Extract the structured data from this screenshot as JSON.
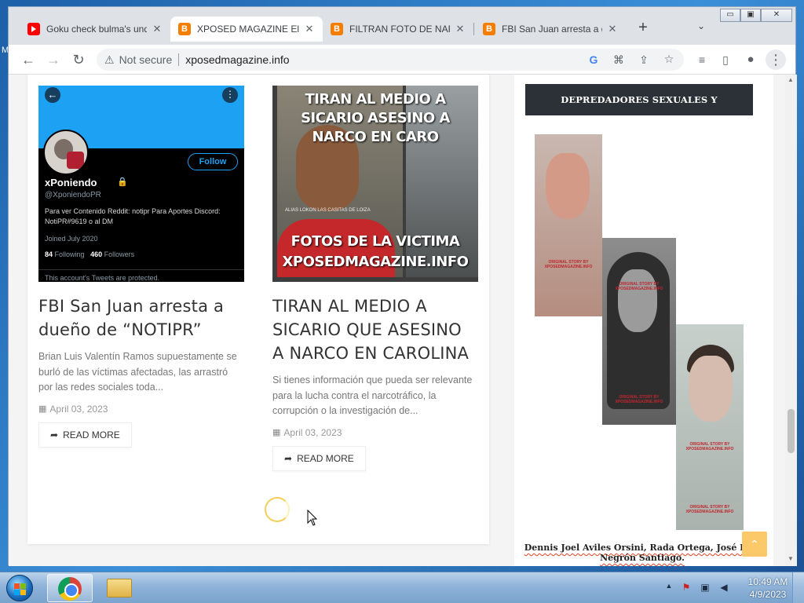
{
  "browser": {
    "tabs": [
      {
        "title": "Goku check bulma's und",
        "favicon": "youtube-icon",
        "active": false
      },
      {
        "title": "XPOSED MAGAZINE Elb",
        "favicon": "blogger-icon",
        "active": true
      },
      {
        "title": "FILTRAN FOTO DE NARC",
        "favicon": "blogger-icon",
        "active": false
      },
      {
        "title": "FBI San Juan arresta a d",
        "favicon": "blogger-icon",
        "active": false
      }
    ],
    "new_tab_label": "+",
    "tab_search_label": "⌄",
    "window_controls": {
      "minimize": "▭",
      "maximize": "▣",
      "close": "✕"
    },
    "address": {
      "security_label": "Not secure",
      "url": "xposedmagazine.info"
    },
    "toolbar_glyphs": {
      "back": "←",
      "forward": "→",
      "reload": "↻",
      "star": "☆",
      "menu": "⋮"
    }
  },
  "posts": [
    {
      "title": "FBI San Juan arresta a dueño de “NOTIPR”",
      "excerpt": "Brian Luis Valentín Ramos supuestamente se burló de las víctimas afectadas, las arrastró por las redes sociales toda...",
      "date": "April 03, 2023",
      "read_more": "READ MORE",
      "image": {
        "name": "xPoniendo",
        "handle": "@XponiendoPR",
        "follow": "Follow",
        "bio": "Para ver Contenido Reddit: notipr  Para Aportes Discord: NotiPR#9619 o al DM",
        "joined": "Joined July 2020",
        "following_count": "84",
        "following_label": "Following",
        "followers_count": "460",
        "followers_label": "Followers",
        "protected": "This account's Tweets are protected."
      }
    },
    {
      "title": "TIRAN AL MEDIO A SICARIO QUE ASESINO A NARCO EN CAROLINA",
      "excerpt": "Si tienes información que pueda ser relevante para la lucha contra el narcotráfico, la corrupción o la investigación de...",
      "date": "April 03, 2023",
      "read_more": "READ MORE",
      "image": {
        "headline_top": "TIRAN AL MEDIO A SICARIO ASESINO A NARCO EN CARO",
        "headline_bottom": "FOTOS DE LA VICTIMA XPOSEDMAGAZINE.INFO",
        "alias": "ALIAS LOKON LAS CASITAS DE LOIZA"
      }
    }
  ],
  "sidebar": {
    "heading": "DEPREDADORES SEXUALES Y CRIMINALES",
    "image_stamp": "ORIGINAL STORY BY XPOSEDMAGAZINE.INFO",
    "caption": "Dennis Joel Aviles Orsini, Rada Ortega, José Luis Negrón Santiago."
  },
  "back_to_top": "⌃",
  "taskbar": {
    "time": "10:49 AM",
    "date": "4/9/2023"
  },
  "colors": {
    "accent": "#f57d00",
    "sidebar_heading_bg": "#2b3136",
    "back_to_top": "#fbc96a",
    "twitter_blue": "#1da1f2"
  }
}
